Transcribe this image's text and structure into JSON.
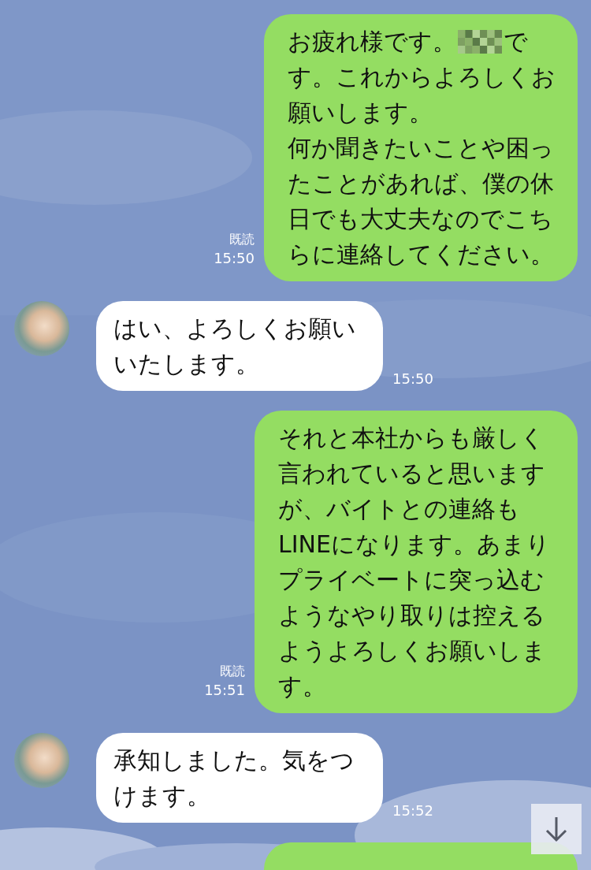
{
  "messages": [
    {
      "kind": "sent",
      "parts": [
        {
          "kind": "line",
          "items": [
            {
              "kind": "text",
              "text": "お疲れ様です。"
            },
            {
              "kind": "mosaic"
            },
            {
              "kind": "text",
              "text": "で"
            }
          ]
        },
        {
          "kind": "text",
          "text": "す。これからよろしくお願いします。"
        },
        {
          "kind": "text",
          "text": "何か聞きたいことや困ったことがあれば、僕の休日でも大丈夫なのでこちらに連絡してください。"
        }
      ],
      "read": "既読",
      "time": "15:50"
    },
    {
      "kind": "received",
      "parts": [
        {
          "kind": "text",
          "text": "はい、よろしくお願いいたします。"
        }
      ],
      "time": "15:50"
    },
    {
      "kind": "sent",
      "parts": [
        {
          "kind": "text",
          "text": "それと本社からも厳しく言われていると思いますが、バイトとの連絡もLINEになります。あまりプライベートに突っ込むようなやり取りは控えるようよろしくお願いします。"
        }
      ],
      "read": "既読",
      "time": "15:51"
    },
    {
      "kind": "received",
      "parts": [
        {
          "kind": "text",
          "text": "承知しました。気をつけます。"
        }
      ],
      "time": "15:52"
    },
    {
      "kind": "sent"
    }
  ]
}
